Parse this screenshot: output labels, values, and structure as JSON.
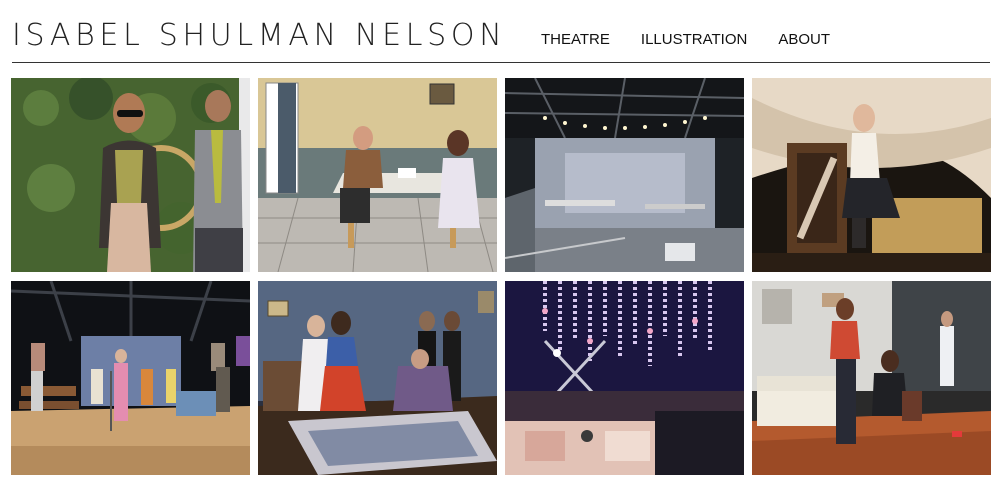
{
  "site": {
    "title": "ISABEL SHULMAN NELSON"
  },
  "nav": {
    "items": [
      {
        "label": "THEATRE"
      },
      {
        "label": "ILLUSTRATION"
      },
      {
        "label": "ABOUT"
      }
    ]
  },
  "gallery": {
    "images": [
      {
        "subject": "actors-hedge-wall"
      },
      {
        "subject": "kitchen-table-scene"
      },
      {
        "subject": "empty-stage-lighting-grid"
      },
      {
        "subject": "actress-on-hay-bale"
      },
      {
        "subject": "ensemble-microphone-scene"
      },
      {
        "subject": "parlor-victorian-costumes"
      },
      {
        "subject": "hanging-flowers-set"
      },
      {
        "subject": "living-room-couch-scene"
      }
    ]
  }
}
